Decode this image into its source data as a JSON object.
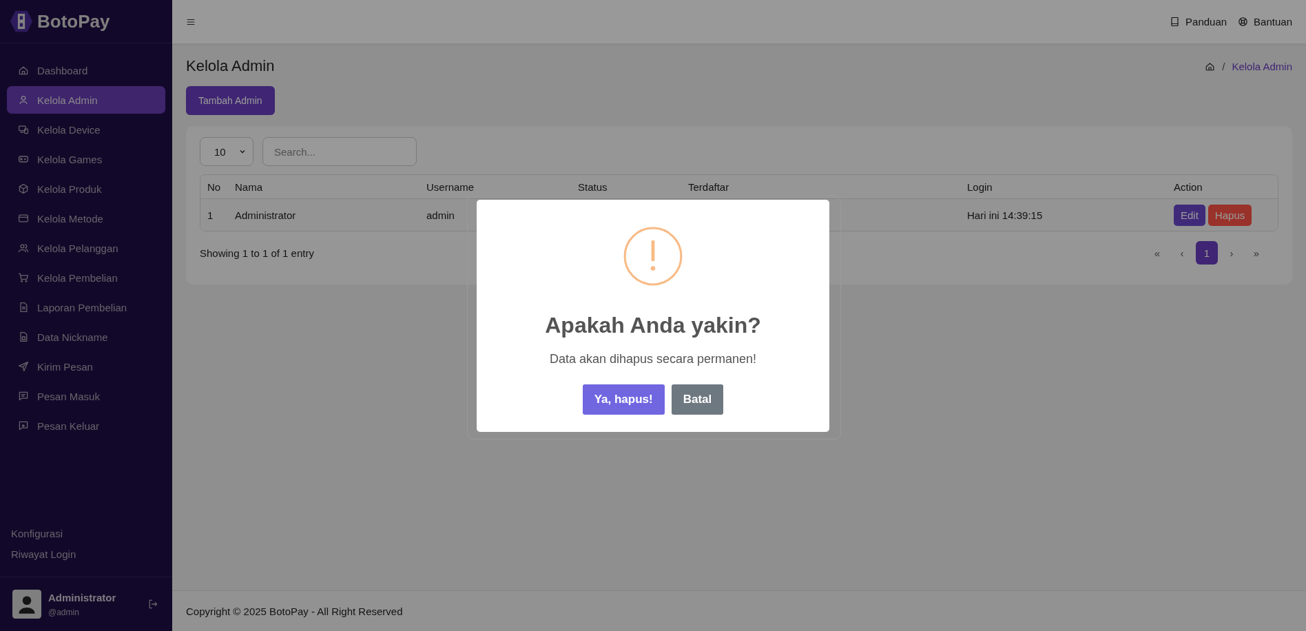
{
  "sidebar": {
    "brand": "BotoPay",
    "items": [
      {
        "label": "Dashboard",
        "selected": false
      },
      {
        "label": "Kelola Admin",
        "selected": true
      },
      {
        "label": "Kelola Device",
        "selected": false
      },
      {
        "label": "Kelola Games",
        "selected": false
      },
      {
        "label": "Kelola Produk",
        "selected": false
      },
      {
        "label": "Kelola Metode",
        "selected": false
      },
      {
        "label": "Kelola Pelanggan",
        "selected": false
      },
      {
        "label": "Kelola Pembelian",
        "selected": false
      },
      {
        "label": "Laporan Pembelian",
        "selected": false
      },
      {
        "label": "Data Nickname",
        "selected": false
      },
      {
        "label": "Kirim Pesan",
        "selected": false
      },
      {
        "label": "Pesan Masuk",
        "selected": false
      },
      {
        "label": "Pesan Keluar",
        "selected": false
      }
    ],
    "bottom_links": [
      "Konfigurasi",
      "Riwayat Login"
    ],
    "user": {
      "name": "Administrator",
      "handle": "@admin"
    }
  },
  "topbar": {
    "links": [
      "Panduan",
      "Bantuan"
    ]
  },
  "page": {
    "title": "Kelola Admin",
    "breadcrumb_separator": "/",
    "breadcrumb": "Kelola Admin",
    "add_button": "Tambah Admin"
  },
  "table": {
    "page_size": "10",
    "search": {
      "placeholder": "Search..."
    },
    "columns": [
      "No",
      "Nama",
      "Username",
      "Status",
      "Terdaftar",
      "Login",
      "Action"
    ],
    "rows": [
      {
        "cells": [
          "1",
          "Administrator",
          "admin",
          null,
          null,
          "Hari ini 14:39:15"
        ],
        "actions": [
          "Edit",
          "Hapus"
        ]
      }
    ],
    "info": "Showing 1 to 1 of 1 entry",
    "pagination": [
      {
        "label": "«",
        "selected": false
      },
      {
        "label": "‹",
        "selected": false
      },
      {
        "label": "1",
        "selected": true
      },
      {
        "label": "›",
        "selected": false
      },
      {
        "label": "»",
        "selected": false
      }
    ]
  },
  "footer": "Copyright © 2025 BotoPay - All Right Reserved",
  "dialog": {
    "title": "Apakah Anda yakin?",
    "text": "Data akan dihapus secara permanen!",
    "confirm": "Ya, hapus!",
    "cancel": "Batal"
  }
}
